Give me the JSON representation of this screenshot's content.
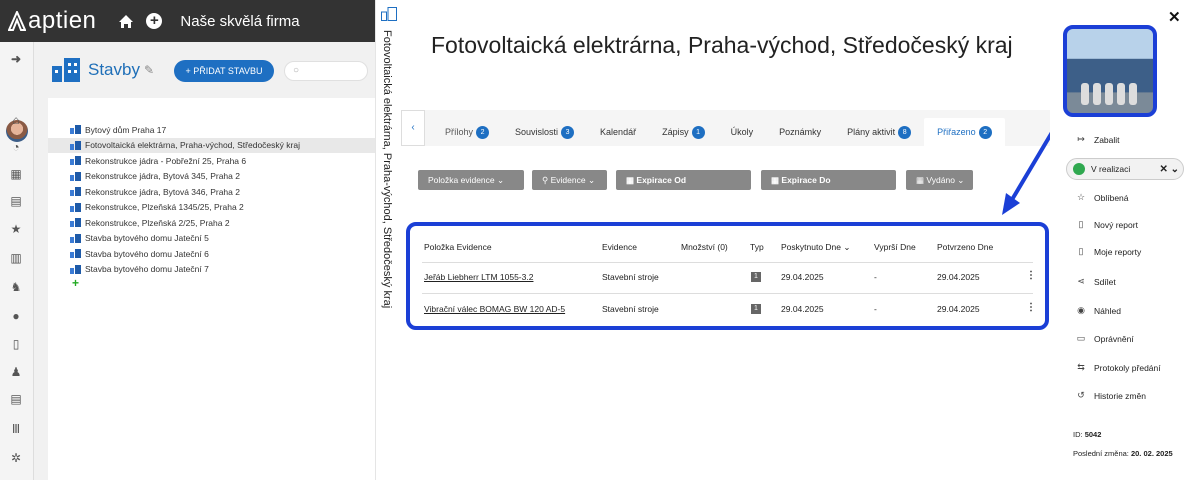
{
  "app": {
    "logo_text": "aptien",
    "company": "Naše skvělá firma"
  },
  "panel": {
    "title": "Stavby",
    "add_button": "+ PŘIDAT STAVBU",
    "search_placeholder": "",
    "tree_items": [
      "Bytový dům Praha 17",
      "Fotovoltaická elektrárna, Praha-východ, Středočeský kraj",
      "Rekonstrukce jádra - Pobřežní 25, Praha 6",
      "Rekonstrukce jádra, Bytová 345, Praha 2",
      "Rekonstrukce jádra, Bytová 346, Praha 2",
      "Rekonstrukce, Plzeňská 1345/25, Praha 2",
      "Rekonstrukce, Plzeňská 2/25, Praha 2",
      "Stavba bytového domu Jateční 5",
      "Stavba bytového domu Jateční 6",
      "Stavba bytového domu Jateční 7"
    ],
    "selected_index": 1
  },
  "vertical_title": "Fotovoltaická elektrárna, Praha-východ, Středočeský kraj",
  "main": {
    "title": "Fotovoltaická elektrárna, Praha-východ, Středočeský kraj",
    "tabs": [
      {
        "label": "Přílohy",
        "badge": "2"
      },
      {
        "label": "Souvislosti",
        "badge": "3"
      },
      {
        "label": "Kalendář",
        "badge": ""
      },
      {
        "label": "Zápisy",
        "badge": "1"
      },
      {
        "label": "Úkoly",
        "badge": ""
      },
      {
        "label": "Poznámky",
        "badge": ""
      },
      {
        "label": "Plány aktivit",
        "badge": "8"
      },
      {
        "label": "Přiřazeno",
        "badge": "2"
      }
    ],
    "active_tab": "Přiřazeno",
    "filters": {
      "item": "Položka evidence",
      "evidence": "Evidence",
      "exp_from": "Expirace Od",
      "exp_to": "Expirace Do",
      "issued": "Vydáno"
    },
    "table": {
      "headers": [
        "Položka Evidence",
        "Evidence",
        "Množství (0)",
        "Typ",
        "Poskytnuto Dne",
        "Vyprší Dne",
        "Potvrzeno Dne"
      ],
      "rows": [
        {
          "item": "Jeřáb Liebherr LTM 1055-3.2",
          "evidence": "Stavební stroje",
          "qty": "",
          "typ": "1",
          "provided": "29.04.2025",
          "expires": "-",
          "confirmed": "29.04.2025"
        },
        {
          "item": "Vibrační válec BOMAG BW 120 AD-5",
          "evidence": "Stavební stroje",
          "qty": "",
          "typ": "1",
          "provided": "29.04.2025",
          "expires": "-",
          "confirmed": "29.04.2025"
        }
      ]
    }
  },
  "sidebar": {
    "collapse": "Zabalit",
    "status": "V realizaci",
    "status_color": "#2fa84f",
    "items": [
      "Oblíbená",
      "Nový report",
      "Moje reporty",
      "Sdílet",
      "Náhled",
      "Oprávnění",
      "Protokoly předání",
      "Historie změn"
    ],
    "icons": [
      "star-icon",
      "document-plus-icon",
      "document-icon",
      "share-icon",
      "eye-icon",
      "id-card-icon",
      "handover-icon",
      "history-icon"
    ],
    "id_label": "ID:",
    "id_value": "5042",
    "last_change_label": "Poslední změna:",
    "last_change_value": "20. 02. 2025"
  },
  "colors": {
    "accent": "#1e6fc2",
    "highlight": "#1b3fd6",
    "topbar": "#333333"
  }
}
